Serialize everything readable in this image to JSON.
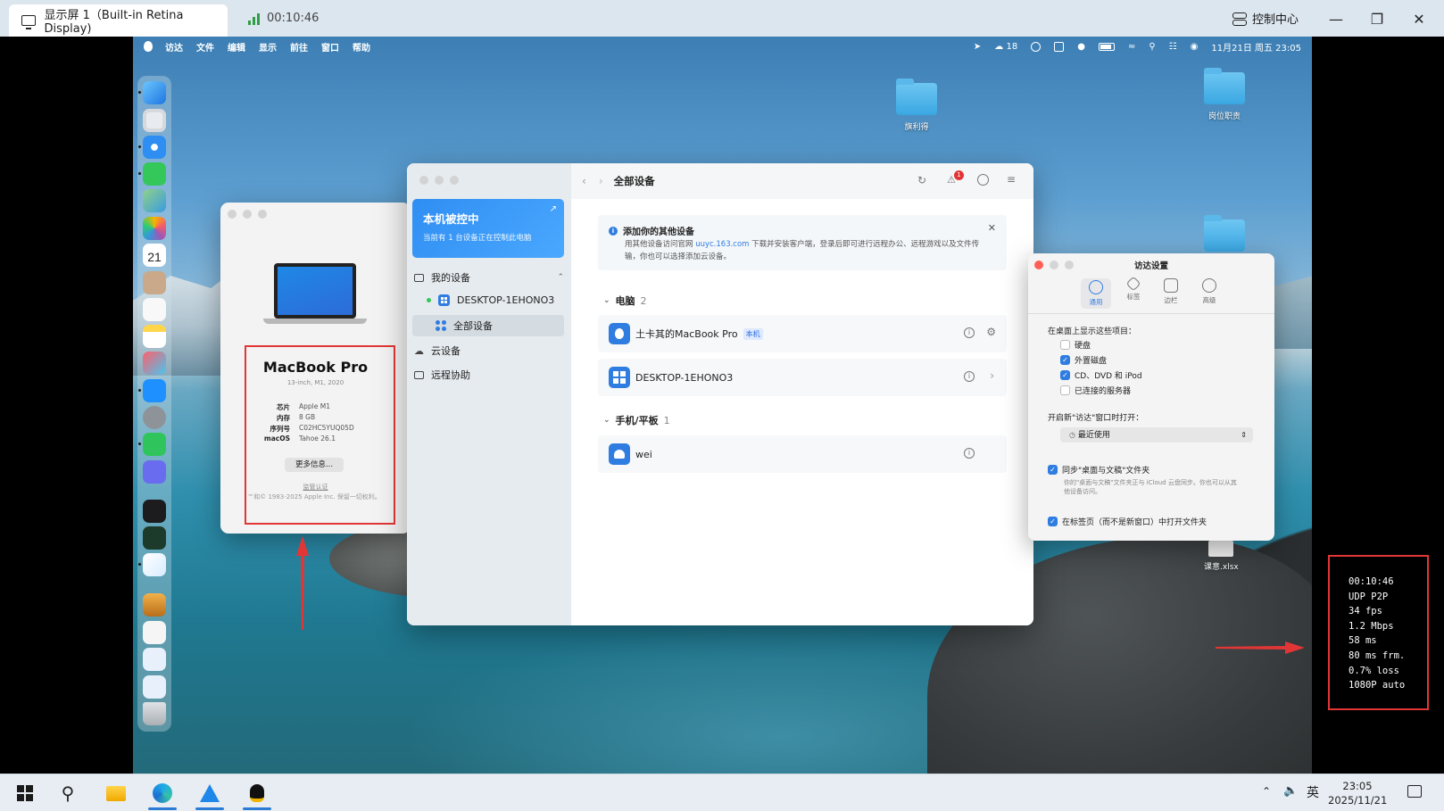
{
  "viewer": {
    "tab_title": "显示屏 1（Built-in Retina Display)",
    "timer": "00:10:46",
    "control_center": "控制中心"
  },
  "menubar": {
    "items": [
      "访达",
      "文件",
      "编辑",
      "显示",
      "前往",
      "窗口",
      "帮助"
    ],
    "wechat_count": "18",
    "datetime": "11月21日 周五 23:05"
  },
  "desktop": {
    "icons": [
      "旗利得",
      "岗位职责",
      "课意.xlsx"
    ]
  },
  "about": {
    "title": "MacBook Pro",
    "subtitle": "13-inch, M1, 2020",
    "specs": [
      {
        "k": "芯片",
        "v": "Apple M1"
      },
      {
        "k": "内存",
        "v": "8 GB"
      },
      {
        "k": "序列号",
        "v": "C02HC5YUQ05D"
      },
      {
        "k": "macOS",
        "v": "Tahoe 26.1"
      }
    ],
    "more_button": "更多信息...",
    "regulatory": "监管认证",
    "copyright": "™和© 1983-2025 Apple Inc. 保留一切权利。"
  },
  "uu": {
    "banner_title": "本机被控中",
    "banner_sub": "当前有 1 台设备正在控制此电脑",
    "sidebar": {
      "my_devices": "我的设备",
      "device_name": "DESKTOP-1EHONO3",
      "all_devices": "全部设备",
      "cloud": "云设备",
      "remote_assist": "远程协助"
    },
    "header_title": "全部设备",
    "notification_count": "1",
    "notice": {
      "title": "添加你的其他设备",
      "body_prefix": "用其他设备访问官网 ",
      "link": "uuyc.163.com",
      "body_suffix": " 下载并安装客户端，登录后即可进行远程办公、远程游戏以及文件传输，你也可以选择添加云设备。"
    },
    "sections": [
      {
        "label": "电脑",
        "count": "2"
      },
      {
        "label": "手机/平板",
        "count": "1"
      }
    ],
    "devices": [
      {
        "name": "土卡其的MacBook Pro",
        "tag": "本机"
      },
      {
        "name": "DESKTOP-1EHONO3",
        "tag": ""
      },
      {
        "name": "wei",
        "tag": ""
      }
    ]
  },
  "finder": {
    "title": "访达设置",
    "tabs": [
      "通用",
      "标签",
      "边栏",
      "高级"
    ],
    "show_label": "在桌面上显示这些项目：",
    "show_items": [
      {
        "label": "硬盘",
        "checked": false
      },
      {
        "label": "外置磁盘",
        "checked": true
      },
      {
        "label": "CD、DVD 和 iPod",
        "checked": true
      },
      {
        "label": "已连接的服务器",
        "checked": false
      }
    ],
    "open_label": "开启新\"访达\"窗口时打开：",
    "open_value": "最近使用",
    "sync_label": "同步\"桌面与文稿\"文件夹",
    "sync_note": "你的\"桌面与文稿\"文件夹正与 iCloud 云盘同步。你也可以从其他设备访问。",
    "tabs_label": "在标签页（而不是新窗口）中打开文件夹"
  },
  "stats": [
    "00:10:46",
    "UDP P2P",
    "34 fps",
    "1.2 Mbps",
    "58 ms",
    "80 ms frm.",
    "0.7% loss",
    "1080P auto"
  ],
  "taskbar": {
    "ime": "英",
    "time": "23:05",
    "date": "2025/11/21"
  },
  "colors": {
    "accent": "#2f7de1",
    "highlight": "#e23636"
  }
}
